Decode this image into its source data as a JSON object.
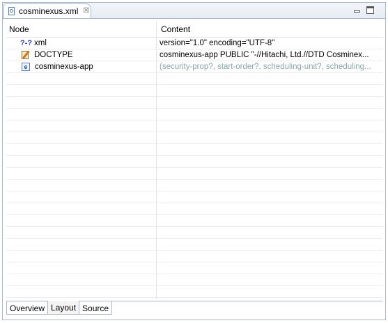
{
  "editor_tab": {
    "title": "cosminexus.xml",
    "close_glyph": "☒"
  },
  "window_controls": {
    "minimize_icon": "minimize-icon",
    "maximize_icon": "maximize-icon"
  },
  "table": {
    "columns": [
      "Node",
      "Content"
    ],
    "rows": [
      {
        "icon": "processing-instruction-icon",
        "icon_text": "?-?",
        "node": "xml",
        "content": "version=\"1.0\" encoding=\"UTF-8\"",
        "muted": false
      },
      {
        "icon": "doctype-icon",
        "node": "DOCTYPE",
        "content": "cosminexus-app PUBLIC \"-//Hitachi, Ltd.//DTD Cosminex...",
        "muted": false
      },
      {
        "icon": "element-icon",
        "icon_text": "e",
        "node": "cosminexus-app",
        "content": "(security-prop?, start-order?, scheduling-unit?, scheduling...",
        "muted": true
      }
    ],
    "empty_row_count": 19
  },
  "bottom_tabs": [
    {
      "label": "Overview",
      "active": false
    },
    {
      "label": "Layout",
      "active": true
    },
    {
      "label": "Source",
      "active": false
    }
  ]
}
